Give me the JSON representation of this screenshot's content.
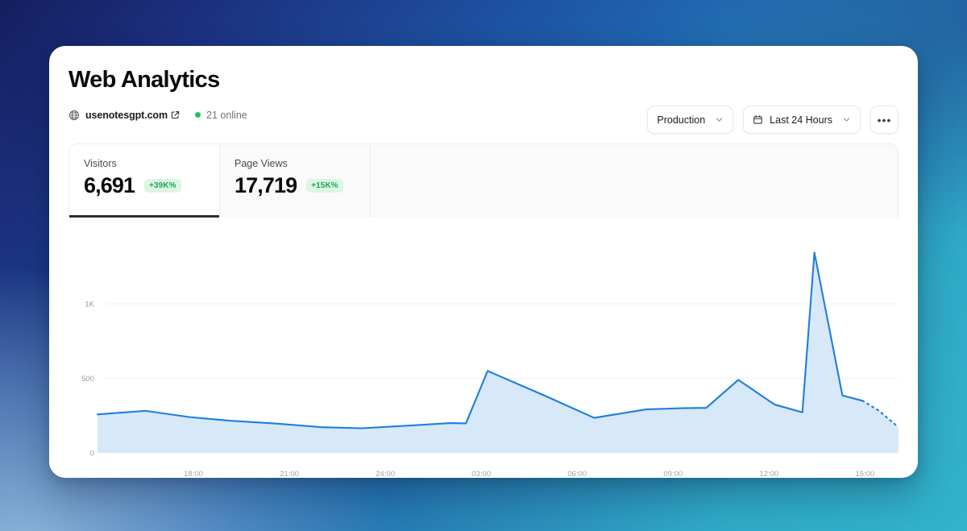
{
  "header": {
    "title": "Web Analytics",
    "domain": "usenotesgpt.com",
    "globe_icon": "globe-icon",
    "external_link_icon": "external-link-icon",
    "online_status": "21 online",
    "online_dot_color": "#22c55e"
  },
  "toolbar": {
    "environment": "Production",
    "environment_chevron": "chevron-down-icon",
    "date_range": "Last 24 Hours",
    "calendar_icon": "calendar-icon",
    "date_chevron": "chevron-down-icon",
    "more_label": "•••",
    "more_icon": "ellipsis-icon"
  },
  "stats": [
    {
      "label": "Visitors",
      "value": "6,691",
      "badge": "+39K%",
      "active": true
    },
    {
      "label": "Page Views",
      "value": "17,719",
      "badge": "+15K%",
      "active": false
    }
  ],
  "colors": {
    "line": "#1d7fdb",
    "fill": "#d7e8f9",
    "badge_bg": "#ddf5e4",
    "badge_text": "#17a95a",
    "active_underline": "#303030",
    "grid": "#f0f0f0"
  },
  "chart_data": {
    "type": "area",
    "title": "Visitors",
    "xlabel": "",
    "ylabel": "",
    "ylim": [
      0,
      1450
    ],
    "yticks": [
      0,
      500,
      1000
    ],
    "ytick_labels": [
      "0",
      "500",
      "1K"
    ],
    "grid": true,
    "legend": "none",
    "x_tick_labels": [
      "18:00",
      "21:00",
      "24:00",
      "03:00",
      "06:00",
      "09:00",
      "12:00",
      "15:00"
    ],
    "x": [
      "16:30",
      "17:00",
      "18:00",
      "19:00",
      "20:00",
      "21:00",
      "22:00",
      "23:00",
      "24:00",
      "01:00",
      "02:00",
      "03:00",
      "04:00",
      "05:00",
      "06:00",
      "07:00",
      "08:00",
      "09:00",
      "10:00",
      "11:00",
      "12:00",
      "13:00",
      "14:00",
      "14:30",
      "15:00"
    ],
    "values": [
      258,
      268,
      278,
      250,
      222,
      205,
      188,
      170,
      160,
      180,
      190,
      215,
      200,
      550,
      330,
      235,
      290,
      300,
      300,
      490,
      330,
      260,
      1345,
      400,
      355,
      170
    ],
    "series": [
      {
        "name": "Visitors",
        "solid_points": [
          {
            "t": 0.0,
            "v": 258
          },
          {
            "t": 0.035,
            "v": 272
          },
          {
            "t": 0.06,
            "v": 282
          },
          {
            "t": 0.115,
            "v": 240
          },
          {
            "t": 0.165,
            "v": 216
          },
          {
            "t": 0.225,
            "v": 196
          },
          {
            "t": 0.28,
            "v": 172
          },
          {
            "t": 0.33,
            "v": 165
          },
          {
            "t": 0.395,
            "v": 185
          },
          {
            "t": 0.44,
            "v": 200
          },
          {
            "t": 0.46,
            "v": 198
          },
          {
            "t": 0.487,
            "v": 550
          },
          {
            "t": 0.56,
            "v": 380
          },
          {
            "t": 0.62,
            "v": 235
          },
          {
            "t": 0.685,
            "v": 292
          },
          {
            "t": 0.73,
            "v": 300
          },
          {
            "t": 0.76,
            "v": 302
          },
          {
            "t": 0.8,
            "v": 490
          },
          {
            "t": 0.845,
            "v": 325
          },
          {
            "t": 0.88,
            "v": 272
          },
          {
            "t": 0.895,
            "v": 1345
          },
          {
            "t": 0.93,
            "v": 385
          },
          {
            "t": 0.955,
            "v": 350
          }
        ],
        "dashed_points": [
          {
            "t": 0.955,
            "v": 350
          },
          {
            "t": 0.975,
            "v": 285
          },
          {
            "t": 1.0,
            "v": 172
          }
        ]
      }
    ]
  }
}
